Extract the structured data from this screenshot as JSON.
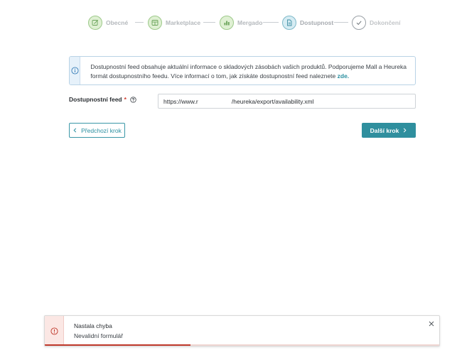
{
  "stepper": {
    "steps": [
      {
        "label": "Obecné",
        "state": "done",
        "icon": "edit-icon"
      },
      {
        "label": "Marketplace",
        "state": "done",
        "icon": "marketplace-icon"
      },
      {
        "label": "Mergado",
        "state": "done",
        "icon": "chart-icon"
      },
      {
        "label": "Dostupnost",
        "state": "active",
        "icon": "document-icon"
      },
      {
        "label": "Dokončení",
        "state": "todo",
        "icon": "check-icon"
      }
    ]
  },
  "info": {
    "text": "Dostupnostní feed obsahuje aktuální informace o skladových zásobách vašich produktů. Podporujeme Mall a Heureka formát dostupnostního feedu. Více informací o tom, jak získáte dostupnostní feed naleznete ",
    "link_text": "zde."
  },
  "form": {
    "feed_label": "Dostupnostní feed",
    "required_mark": "*",
    "feed_value": "https://www.r                    /heureka/export/availability.xml"
  },
  "buttons": {
    "prev_label": "Předchozí krok",
    "next_label": "Další krok"
  },
  "toast": {
    "title": "Nastala chyba",
    "message": "Nevalidní formulář",
    "progress": 0.37
  },
  "colors": {
    "accent": "#2f8f9e",
    "done_bg": "#dff0d3",
    "error": "#c0392b"
  }
}
